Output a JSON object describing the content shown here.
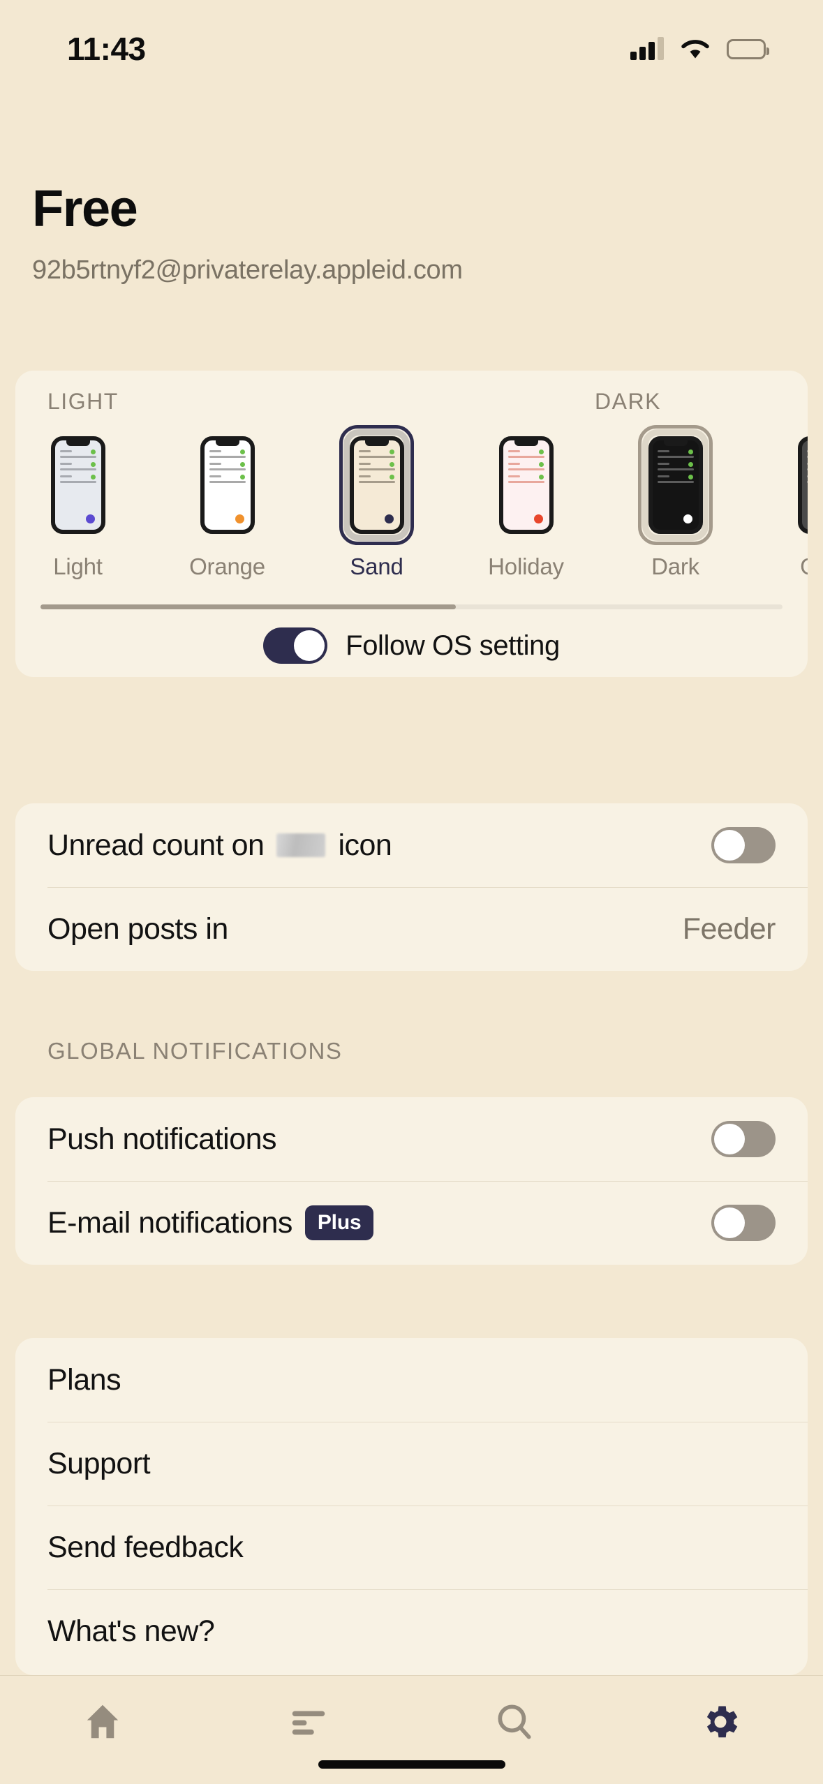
{
  "status_bar": {
    "time": "11:43",
    "signal_icon": "cellular-signal-icon",
    "wifi_icon": "wifi-icon",
    "battery_icon": "battery-low-power-icon"
  },
  "header": {
    "plan_title": "Free",
    "account_email": "92b5rtnyf2@privaterelay.appleid.com"
  },
  "theme_picker": {
    "light_group_label": "LIGHT",
    "dark_group_label": "DARK",
    "themes": [
      {
        "name": "Light",
        "group": "light",
        "selected": false,
        "bg": "#e7eaef",
        "line": "#a7aab0",
        "accent": "#5b4ad1"
      },
      {
        "name": "Orange",
        "group": "light",
        "selected": false,
        "bg": "#ffffff",
        "line": "#a9a9a9",
        "accent": "#f0912d"
      },
      {
        "name": "Sand",
        "group": "light",
        "selected": true,
        "bg": "#f5ead6",
        "line": "#a69c8b",
        "accent": "#2e2d4e"
      },
      {
        "name": "Holiday",
        "group": "light",
        "selected": false,
        "bg": "#fdf1f1",
        "line": "#e8a79c",
        "accent": "#e8462c"
      },
      {
        "name": "Dark",
        "group": "dark",
        "selected": true,
        "bg": "#141414",
        "line": "#5c5c5c",
        "accent": "#ffffff"
      },
      {
        "name": "Grey",
        "group": "dark",
        "selected": false,
        "bg": "#4a4a4a",
        "line": "#8e8e8e",
        "accent": "#ffffff"
      }
    ],
    "follow_os_label": "Follow OS setting",
    "follow_os_enabled": "on"
  },
  "app_settings": {
    "unread_count_label_before": "Unread count on",
    "unread_count_label_redacted": "app-name-redacted",
    "unread_count_label_after": "icon",
    "unread_count_enabled": "off",
    "open_posts_label": "Open posts in",
    "open_posts_value": "Feeder"
  },
  "notifications": {
    "group_label": "GLOBAL NOTIFICATIONS",
    "rows": [
      {
        "label": "Push notifications",
        "badge": "",
        "enabled": "off"
      },
      {
        "label": "E-mail notifications",
        "badge": "Plus",
        "enabled": "off"
      }
    ]
  },
  "links": {
    "rows": [
      {
        "label": "Plans"
      },
      {
        "label": "Support"
      },
      {
        "label": "Send feedback"
      },
      {
        "label": "What's new?"
      }
    ]
  },
  "bottom_nav": {
    "items": [
      {
        "name": "home",
        "icon": "home-icon",
        "active": false
      },
      {
        "name": "feed",
        "icon": "list-icon",
        "active": false
      },
      {
        "name": "search",
        "icon": "search-icon",
        "active": false
      },
      {
        "name": "settings",
        "icon": "gear-icon",
        "active": true
      }
    ],
    "active_color": "#2e2d4e",
    "inactive_color": "#958c7e"
  },
  "colors": {
    "page_bg": "#f3e8d2",
    "card_bg": "#f8f2e4",
    "accent": "#2e2d4e",
    "muted_text": "#8a8174"
  }
}
